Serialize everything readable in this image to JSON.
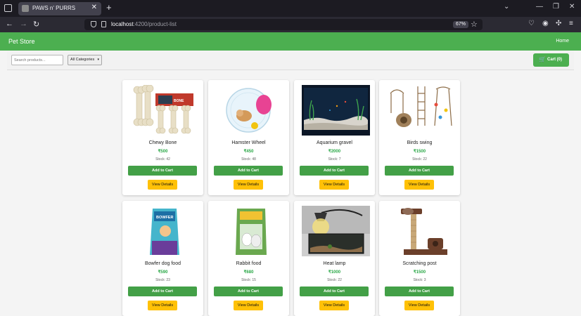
{
  "browser": {
    "tab_title": "PAWS n' PURRS",
    "url_host": "localhost",
    "url_path": ":4200/product-list",
    "zoom": "67%"
  },
  "header": {
    "brand": "Pet Store",
    "home_link": "Home"
  },
  "toolbar": {
    "search_placeholder": "Search products...",
    "category_selected": "All Categories",
    "cart_label": "Cart (0)"
  },
  "labels": {
    "add_to_cart": "Add to Cart",
    "view_details": "View Details"
  },
  "products": [
    {
      "name": "Chewy Bone",
      "price": "₹500",
      "stock": "Stock: 42"
    },
    {
      "name": "Hamster Wheel",
      "price": "₹450",
      "stock": "Stock: 48"
    },
    {
      "name": "Aquarium gravel",
      "price": "₹2000",
      "stock": "Stock: 7"
    },
    {
      "name": "Birds swing",
      "price": "₹1500",
      "stock": "Stock: 22"
    },
    {
      "name": "Bowfer dog food",
      "price": "₹590",
      "stock": "Stock: 23"
    },
    {
      "name": "Rabbit food",
      "price": "₹680",
      "stock": "Stock: 15"
    },
    {
      "name": "Heat lamp",
      "price": "₹1000",
      "stock": "Stock: 22"
    },
    {
      "name": "Scratching post",
      "price": "₹1500",
      "stock": "Stock: 3"
    }
  ],
  "colors": {
    "header": "#4caf50",
    "add_button": "#43a047",
    "view_button": "#ffc107",
    "price": "#28a745"
  }
}
